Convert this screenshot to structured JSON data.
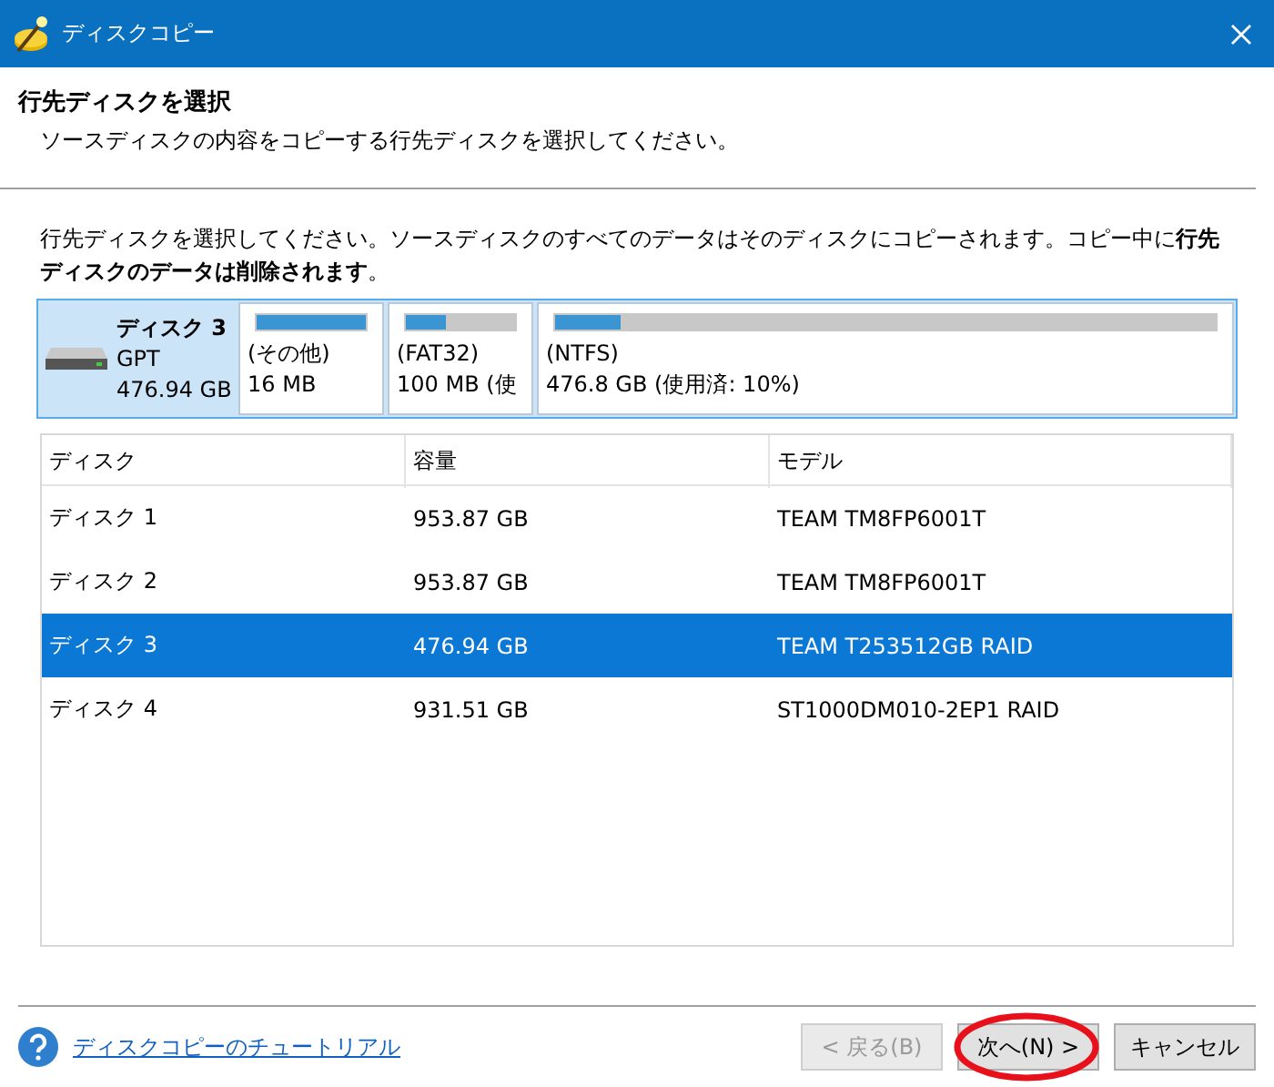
{
  "window": {
    "title": "ディスクコピー"
  },
  "header": {
    "title": "行先ディスクを選択",
    "subtitle": "ソースディスクの内容をコピーする行先ディスクを選択してください。"
  },
  "instruction": "行先ディスクを選択してください。ソースディスクのすべてのデータはそのディスクにコピーされます。コピー中に**行先ディスクのデータは削除されます**。",
  "disk_map": {
    "name": "ディスク 3",
    "style": "GPT",
    "size": "476.94 GB",
    "selected": true,
    "partitions": [
      {
        "label": "(その他)",
        "detail": "16 MB",
        "level": 1.0
      },
      {
        "label": "(FAT32)",
        "detail": "100 MB (使",
        "level": 0.36
      },
      {
        "label": "(NTFS)",
        "detail": "476.8 GB (使用済: 10%)",
        "level": 0.1
      }
    ]
  },
  "table": {
    "columns": [
      "ディスク",
      "容量",
      "モデル"
    ],
    "rows": [
      {
        "cells": [
          "ディスク 1",
          "953.87 GB",
          "TEAM TM8FP6001T"
        ],
        "selected": false
      },
      {
        "cells": [
          "ディスク 2",
          "953.87 GB",
          "TEAM TM8FP6001T"
        ],
        "selected": false
      },
      {
        "cells": [
          "ディスク 3",
          "476.94 GB",
          "TEAM T253512GB RAID"
        ],
        "selected": true
      },
      {
        "cells": [
          "ディスク 4",
          "931.51 GB",
          "ST1000DM010-2EP1 RAID"
        ],
        "selected": false
      }
    ]
  },
  "footer": {
    "link": "ディスクコピーのチュートリアル",
    "buttons": [
      {
        "label": "< 戻る(B)",
        "disabled": true
      },
      {
        "label": "次へ(N) >",
        "disabled": false,
        "circled": true
      },
      {
        "label": "キャンセル",
        "disabled": false
      }
    ]
  }
}
